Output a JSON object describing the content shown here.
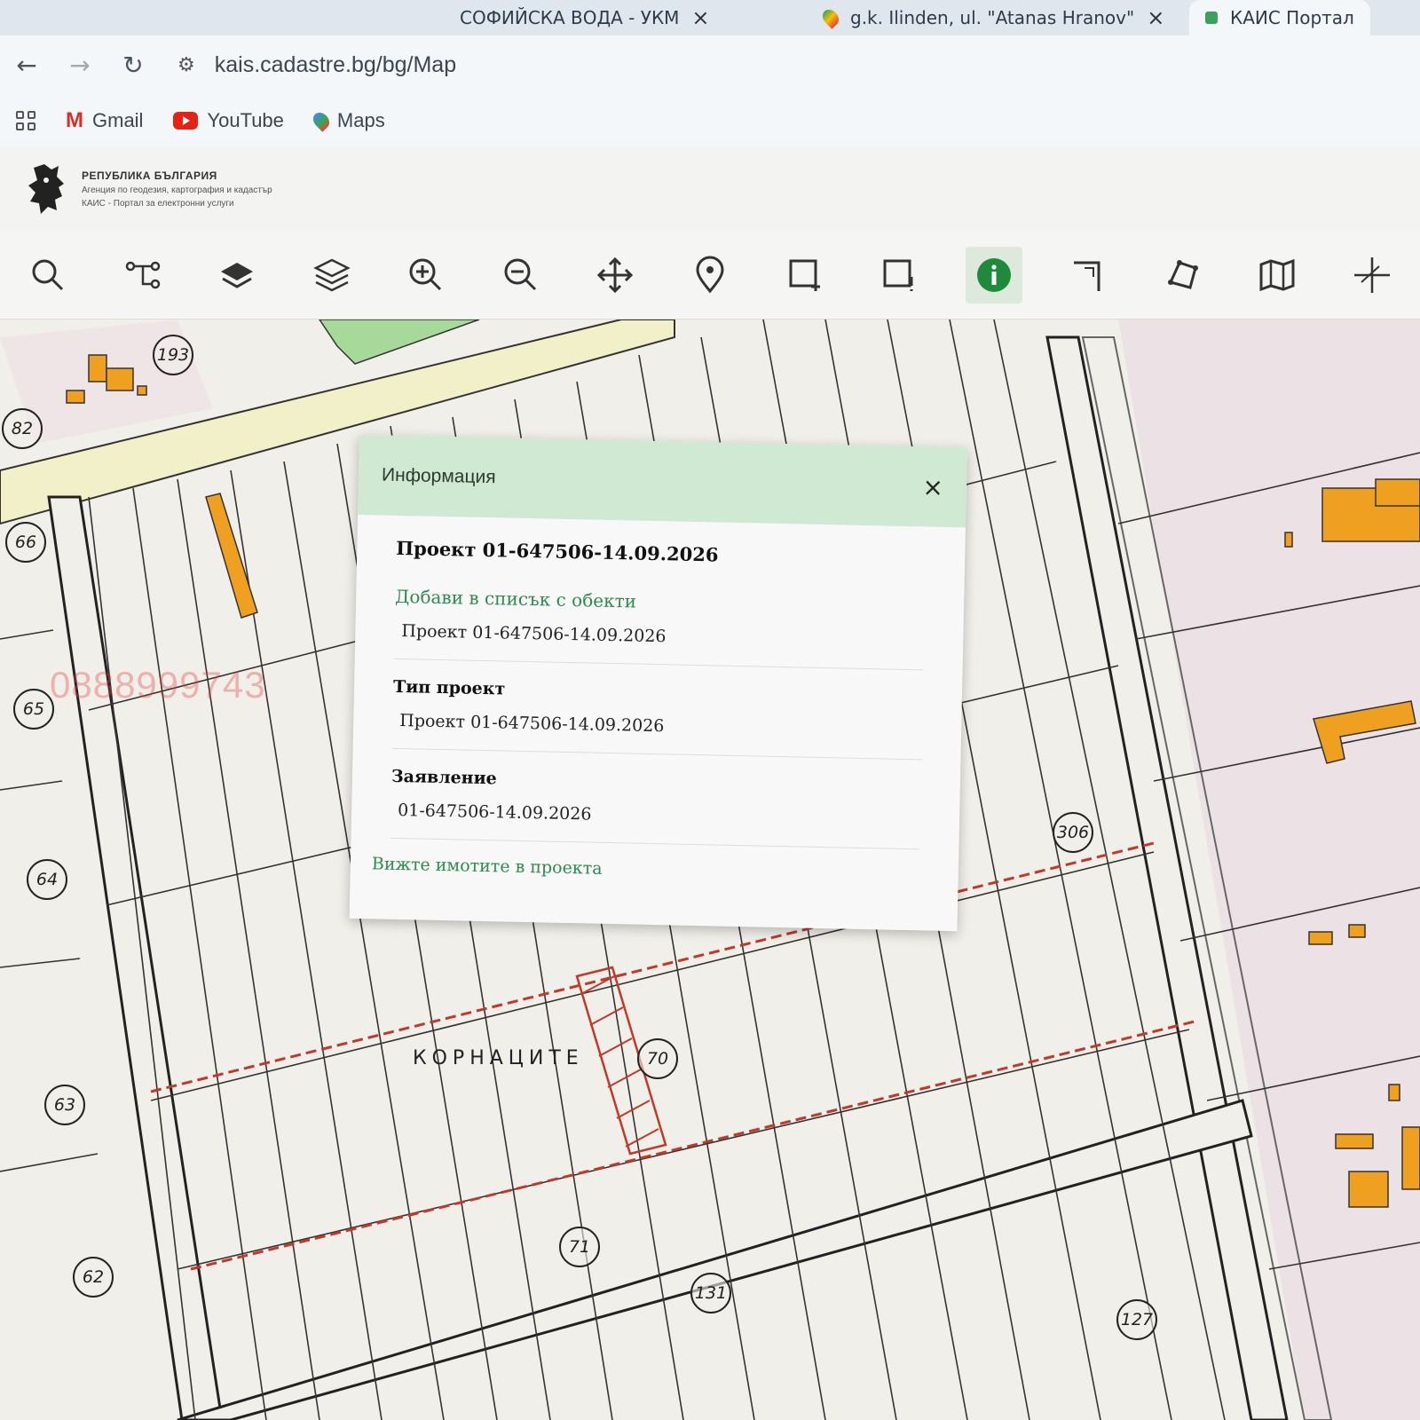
{
  "browser": {
    "tabs": [
      {
        "title": "СОФИЙСКА ВОДА - УКМ",
        "close": "×"
      },
      {
        "title": "g.k. Ilinden, ul. \"Atanas Hranov\"",
        "close": "×"
      },
      {
        "title": "КАИС Портал",
        "close": ""
      }
    ],
    "url": "kais.cadastre.bg/bg/Map",
    "bookmarks": [
      {
        "label": "Gmail",
        "icon": "gmail-icon"
      },
      {
        "label": "YouTube",
        "icon": "youtube-icon"
      },
      {
        "label": "Maps",
        "icon": "maps-icon"
      }
    ]
  },
  "portal": {
    "line1": "РЕПУБЛИКА БЪЛГАРИЯ",
    "line2": "Агенция по геодезия, картография и кадастър",
    "line3": "КАИС - Портал за електронни услуги"
  },
  "map_tools": [
    "search-icon",
    "route-icon",
    "layers-filled-icon",
    "layers-outline-icon",
    "zoom-in-icon",
    "zoom-out-icon",
    "pan-icon",
    "location-pin-icon",
    "select-rectangle-icon",
    "select-rectangle-alt-icon",
    "info-icon",
    "measure-line-icon",
    "measure-polygon-icon",
    "map-icon",
    "crosshair-icon"
  ],
  "map": {
    "plot_labels": [
      "193",
      "82",
      "66",
      "65",
      "64",
      "63",
      "62",
      "306",
      "70",
      "71",
      "131",
      "127",
      "64"
    ],
    "locality": "КОРНАЦИТЕ",
    "watermark": "0888999743"
  },
  "dialog": {
    "title": "Информация",
    "close": "×",
    "project_title": "Проект 01-647506-14.09.2026",
    "add_link": "Добави в списък с обекти",
    "project_value": "Проект 01-647506-14.09.2026",
    "type_label": "Тип проект",
    "type_value": "Проект 01-647506-14.09.2026",
    "application_label": "Заявление",
    "application_value": "01-647506-14.09.2026",
    "view_link": "Вижте имотите в проекта"
  },
  "colors": {
    "dialog_header": "#cfe9d3",
    "link": "#2f8a4f",
    "info_active": "#1f8a3c",
    "building": "#f0a020",
    "project_border": "#c0392b"
  }
}
